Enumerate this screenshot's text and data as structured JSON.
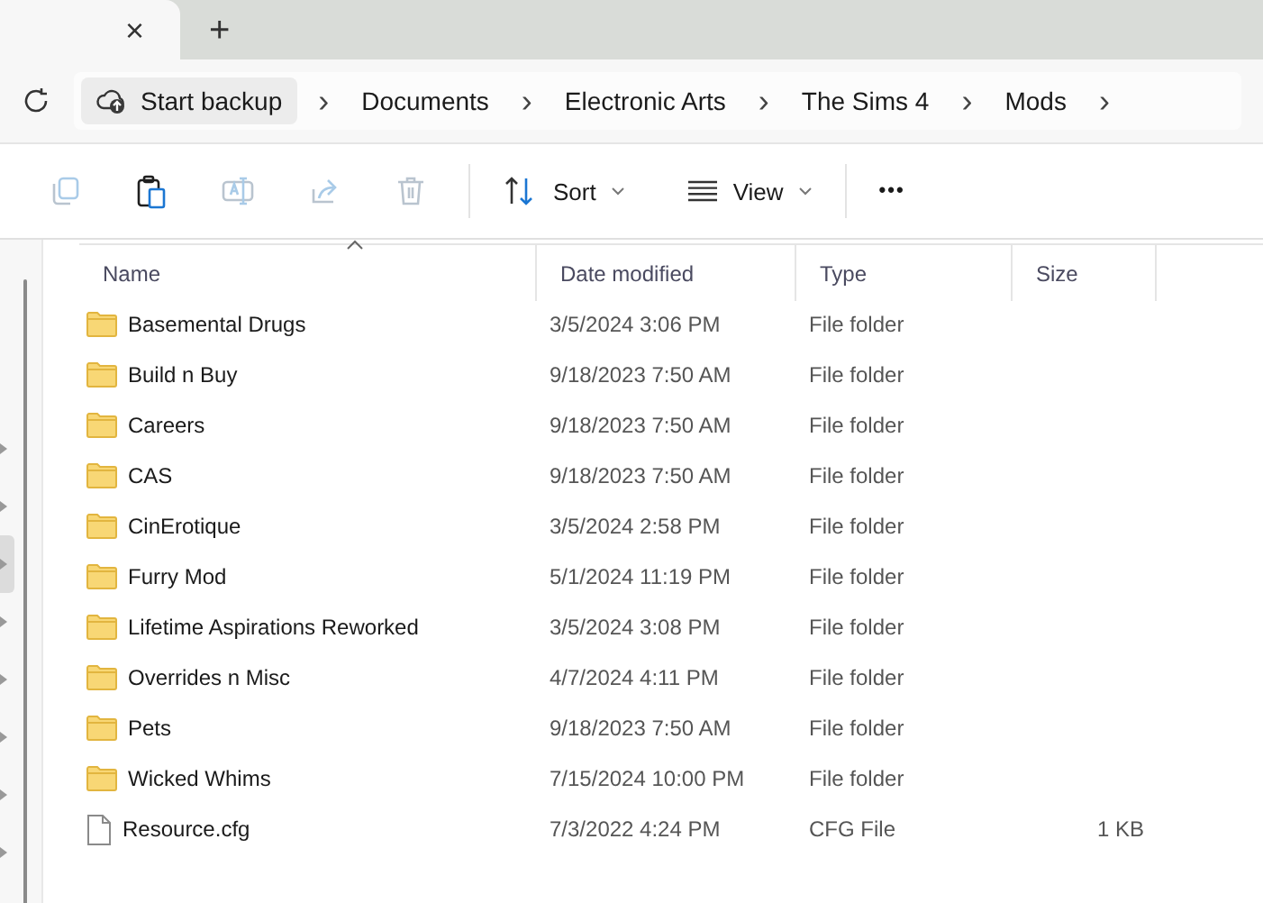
{
  "tab": {
    "close": "×",
    "new_tab": "+"
  },
  "address_bar": {
    "backup": "Start backup",
    "crumbs": [
      "Documents",
      "Electronic Arts",
      "The Sims 4",
      "Mods"
    ],
    "separator": "›"
  },
  "toolbar": {
    "actions": [
      {
        "kind": "copy",
        "disabled": true
      },
      {
        "kind": "paste",
        "disabled": false
      },
      {
        "kind": "rename",
        "disabled": true
      },
      {
        "kind": "share",
        "disabled": true
      },
      {
        "kind": "delete",
        "disabled": true
      }
    ],
    "sort": "Sort",
    "view": "View",
    "more": "•••"
  },
  "nav_pane": {
    "items": [
      {
        "selected": false
      },
      {
        "selected": false
      },
      {
        "selected": true
      },
      {
        "selected": false
      },
      {
        "selected": false
      },
      {
        "selected": false
      },
      {
        "selected": false
      },
      {
        "selected": false
      }
    ]
  },
  "table": {
    "columns": [
      "Name",
      "Date modified",
      "Type",
      "Size"
    ],
    "rows": [
      {
        "kind": "folder",
        "name": "Basemental Drugs",
        "date": "3/5/2024 3:06 PM",
        "type": "File folder"
      },
      {
        "kind": "folder",
        "name": "Build n Buy",
        "date": "9/18/2023 7:50 AM",
        "type": "File folder"
      },
      {
        "kind": "folder",
        "name": "Careers",
        "date": "9/18/2023 7:50 AM",
        "type": "File folder"
      },
      {
        "kind": "folder",
        "name": "CAS",
        "date": "9/18/2023 7:50 AM",
        "type": "File folder"
      },
      {
        "kind": "folder",
        "name": "CinErotique",
        "date": "3/5/2024 2:58 PM",
        "type": "File folder"
      },
      {
        "kind": "folder",
        "name": "Furry Mod",
        "date": "5/1/2024 11:19 PM",
        "type": "File folder"
      },
      {
        "kind": "folder",
        "name": "Lifetime Aspirations Reworked",
        "date": "3/5/2024 3:08 PM",
        "type": "File folder"
      },
      {
        "kind": "folder",
        "name": "Overrides n Misc",
        "date": "4/7/2024 4:11 PM",
        "type": "File folder"
      },
      {
        "kind": "folder",
        "name": "Pets",
        "date": "9/18/2023 7:50 AM",
        "type": "File folder"
      },
      {
        "kind": "folder",
        "name": "Wicked Whims",
        "date": "7/15/2024 10:00 PM",
        "type": "File folder"
      },
      {
        "kind": "file",
        "name": "Resource.cfg",
        "date": "7/3/2022 4:24 PM",
        "type": "CFG File",
        "size": "1 KB"
      }
    ]
  }
}
